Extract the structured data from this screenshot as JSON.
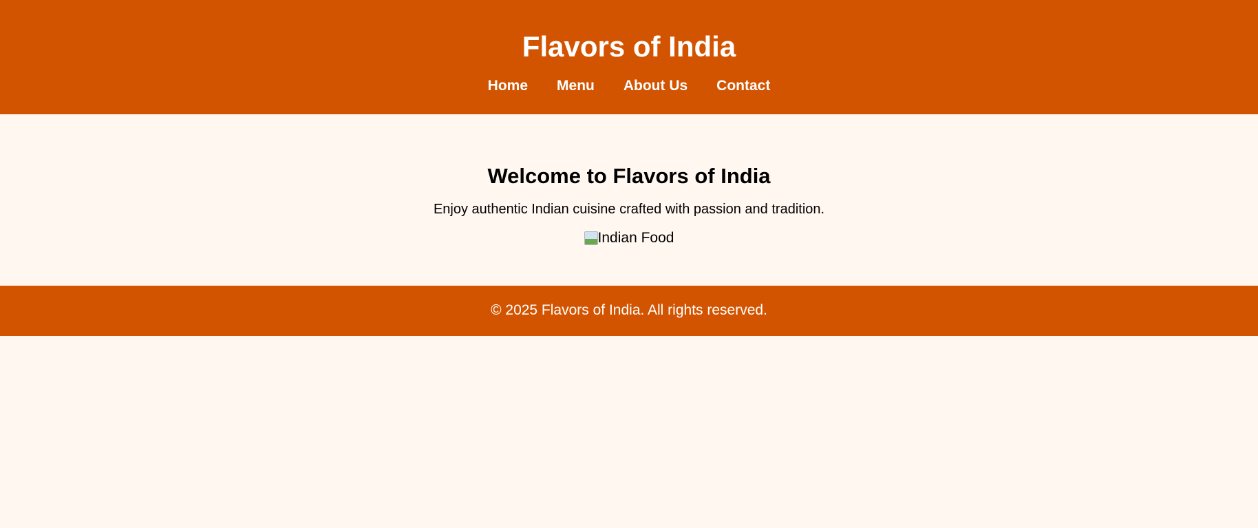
{
  "header": {
    "title": "Flavors of India",
    "nav": [
      {
        "label": "Home"
      },
      {
        "label": "Menu"
      },
      {
        "label": "About Us"
      },
      {
        "label": "Contact"
      }
    ]
  },
  "main": {
    "heading": "Welcome to Flavors of India",
    "tagline": "Enjoy authentic Indian cuisine crafted with passion and tradition.",
    "image_alt": "Indian Food"
  },
  "footer": {
    "copyright": "© 2025 Flavors of India. All rights reserved."
  },
  "colors": {
    "brand": "#d35400",
    "background": "#fff7f0",
    "header_text": "#ffffff"
  }
}
